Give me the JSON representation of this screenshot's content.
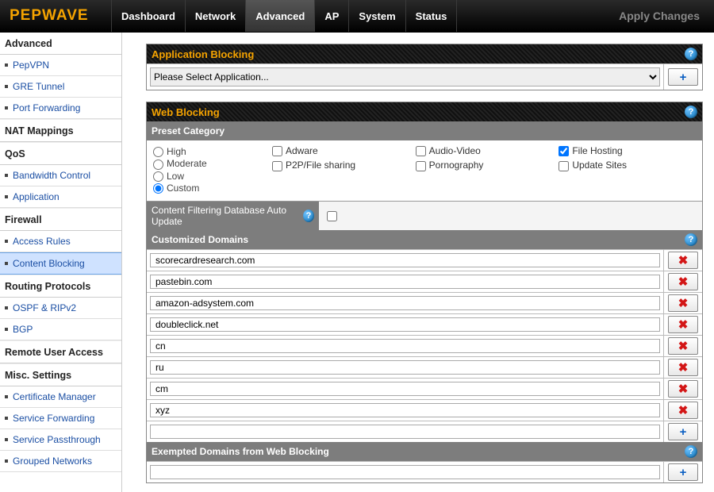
{
  "brand": "PEPWAVE",
  "nav": {
    "items": [
      "Dashboard",
      "Network",
      "Advanced",
      "AP",
      "System",
      "Status"
    ],
    "active": 2,
    "apply": "Apply Changes"
  },
  "sidebar": [
    {
      "type": "h",
      "label": "Advanced"
    },
    {
      "type": "i",
      "label": "PepVPN"
    },
    {
      "type": "i",
      "label": "GRE Tunnel"
    },
    {
      "type": "i",
      "label": "Port Forwarding"
    },
    {
      "type": "h",
      "label": "NAT Mappings"
    },
    {
      "type": "h",
      "label": "QoS"
    },
    {
      "type": "i",
      "label": "Bandwidth Control"
    },
    {
      "type": "i",
      "label": "Application"
    },
    {
      "type": "h",
      "label": "Firewall"
    },
    {
      "type": "i",
      "label": "Access Rules"
    },
    {
      "type": "i",
      "label": "Content Blocking",
      "active": true
    },
    {
      "type": "h",
      "label": "Routing Protocols"
    },
    {
      "type": "i",
      "label": "OSPF & RIPv2"
    },
    {
      "type": "i",
      "label": "BGP"
    },
    {
      "type": "h",
      "label": "Remote User Access"
    },
    {
      "type": "h",
      "label": "Misc. Settings"
    },
    {
      "type": "i",
      "label": "Certificate Manager"
    },
    {
      "type": "i",
      "label": "Service Forwarding"
    },
    {
      "type": "i",
      "label": "Service Passthrough"
    },
    {
      "type": "i",
      "label": "Grouped Networks"
    }
  ],
  "appBlocking": {
    "title": "Application Blocking",
    "select_placeholder": "Please Select Application..."
  },
  "webBlocking": {
    "title": "Web Blocking",
    "presetTitle": "Preset Category",
    "radios": [
      "High",
      "Moderate",
      "Low",
      "Custom"
    ],
    "radio_selected": "Custom",
    "checkboxes": [
      {
        "label": "Adware",
        "checked": false
      },
      {
        "label": "Audio-Video",
        "checked": false
      },
      {
        "label": "File Hosting",
        "checked": true
      },
      {
        "label": "P2P/File sharing",
        "checked": false
      },
      {
        "label": "Pornography",
        "checked": false
      },
      {
        "label": "Update Sites",
        "checked": false
      }
    ],
    "autoUpdateLabel": "Content Filtering Database Auto Update",
    "autoUpdateChecked": false,
    "customTitle": "Customized Domains",
    "domains": [
      "scorecardresearch.com",
      "pastebin.com",
      "amazon-adsystem.com",
      "doubleclick.net",
      "cn",
      "ru",
      "cm",
      "xyz"
    ],
    "exemptTitle": "Exempted Domains from Web Blocking"
  }
}
